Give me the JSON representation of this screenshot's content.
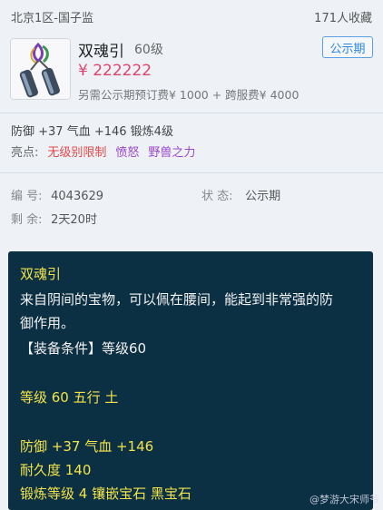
{
  "header": {
    "server": "北京1区-国子监",
    "favorites": "171人收藏"
  },
  "item": {
    "name": "双魂引",
    "level": "60级",
    "status_badge": "公示期",
    "price": "¥ 222222",
    "extra_fees": "另需公示期预订费¥ 1000 + 跨服费¥ 4000",
    "icon": "twin-bell-pendant-icon"
  },
  "attrs": {
    "line": "防御 +37 气血 +146 锻炼4级",
    "highlight_label": "亮点:",
    "highlights": [
      "无级别限制",
      "愤怒",
      "野兽之力"
    ]
  },
  "info": {
    "id_label": "编 号:",
    "id_value": "4043629",
    "state_label": "状 态:",
    "state_value": "公示期",
    "remain_label": "剩 余:",
    "remain_value": "2天20时"
  },
  "tooltip": {
    "title": "双魂引",
    "desc1": "来自阴间的宝物，可以佩在腰间，能起到非常强的防",
    "desc2": "御作用。",
    "req": "【装备条件】等级60",
    "level_line": "等级 60 五行 土",
    "stat_line": "防御 +37 气血 +146",
    "durability": "耐久度 140",
    "gem_line": "锻炼等级 4 镶嵌宝石 黑宝石"
  },
  "watermark": "@梦游大宋师爷",
  "colors": {
    "price": "#e0436a",
    "accent": "#2f86dd",
    "tooltip_bg": "#0b2f43"
  }
}
